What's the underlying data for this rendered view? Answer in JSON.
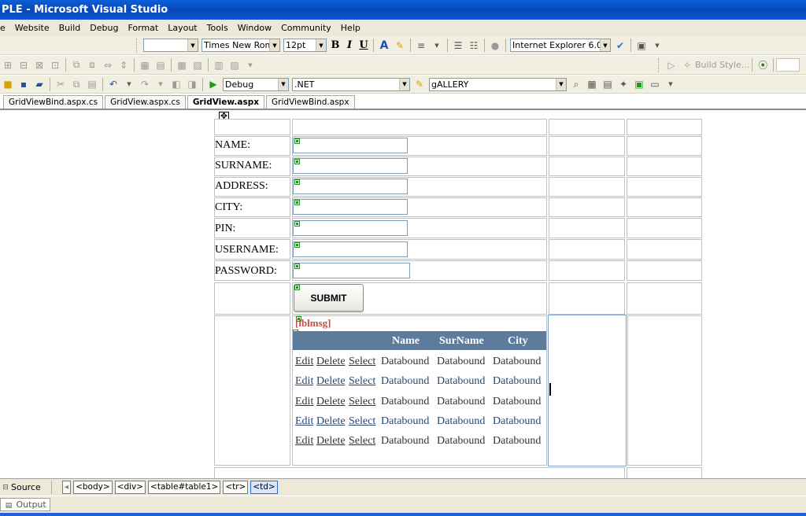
{
  "window": {
    "title": "PLE - Microsoft Visual Studio"
  },
  "menu": [
    "e",
    "Website",
    "Build",
    "Debug",
    "Format",
    "Layout",
    "Tools",
    "Window",
    "Community",
    "Help"
  ],
  "toolbar_format": {
    "font_name": "Times New Roman",
    "font_size": "12pt",
    "bold": "B",
    "italic": "I",
    "underline": "U",
    "target_schema": "Internet Explorer 6.0"
  },
  "toolbar_layout": {
    "build_style": "Build Style..."
  },
  "toolbar_standard": {
    "configuration": "Debug",
    "platform": ".NET",
    "find_text": "gALLERY"
  },
  "tabs": [
    {
      "label": "GridViewBind.aspx.cs",
      "active": false
    },
    {
      "label": "GridView.aspx.cs",
      "active": false
    },
    {
      "label": "GridView.aspx",
      "active": true
    },
    {
      "label": "GridViewBind.aspx",
      "active": false
    }
  ],
  "form": {
    "fields": [
      {
        "label": "NAME:"
      },
      {
        "label": "SURNAME:"
      },
      {
        "label": "ADDRESS:"
      },
      {
        "label": "CITY:"
      },
      {
        "label": "PIN:"
      },
      {
        "label": "USERNAME:"
      },
      {
        "label": "PASSWORD:"
      }
    ],
    "submit_label": "SUBMIT",
    "message_label": "[lblmsg]"
  },
  "gridview": {
    "headers": [
      "Name",
      "SurName",
      "City"
    ],
    "command_links": [
      "Edit",
      "Delete",
      "Select"
    ],
    "rows": [
      [
        "Databound",
        "Databound",
        "Databound"
      ],
      [
        "Databound",
        "Databound",
        "Databound"
      ],
      [
        "Databound",
        "Databound",
        "Databound"
      ],
      [
        "Databound",
        "Databound",
        "Databound"
      ],
      [
        "Databound",
        "Databound",
        "Databound"
      ]
    ],
    "header_color": "#5d7b9d",
    "alt_row_color": "#284775"
  },
  "bottom": {
    "source_label": "Source",
    "breadcrumbs": [
      "<body>",
      "<div>",
      "<table#table1>",
      "<tr>",
      "<td>"
    ],
    "output_label": "Output"
  }
}
